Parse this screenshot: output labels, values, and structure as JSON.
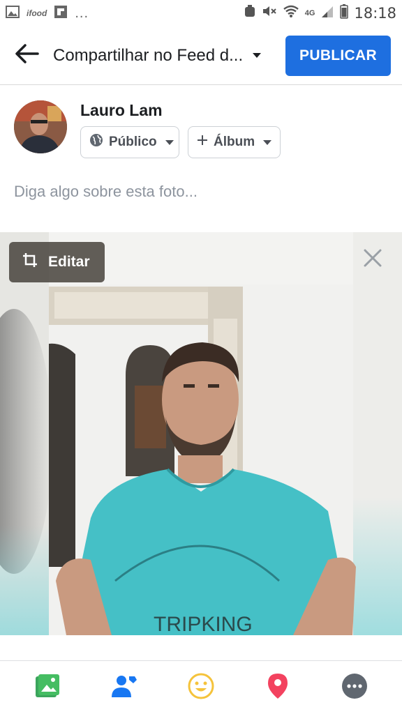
{
  "status_bar": {
    "app_label": "ifood",
    "more": "...",
    "network": "4G",
    "time": "18:18"
  },
  "header": {
    "title": "Compartilhar no Feed d...",
    "publish_label": "PUBLICAR",
    "accent_color": "#1e6fe0"
  },
  "composer": {
    "user_name": "Lauro Lam",
    "audience_label": "Público",
    "album_label": "Álbum",
    "caption_placeholder": "Diga algo sobre esta foto..."
  },
  "photo": {
    "edit_label": "Editar",
    "shirt_text": "TRIPKING"
  },
  "toolbar": {
    "items": [
      "photo-icon",
      "tag-people-icon",
      "feeling-icon",
      "location-icon",
      "more-icon"
    ]
  }
}
